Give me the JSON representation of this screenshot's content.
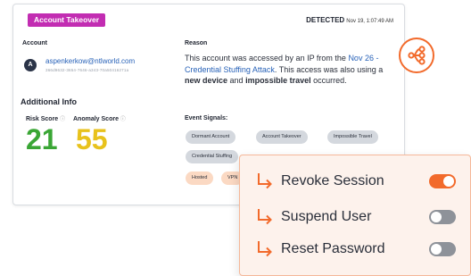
{
  "alert": {
    "badge_label": "Account Takeover",
    "detected_label": "DETECTED",
    "detected_time": "Nov 19, 1:07:49 AM"
  },
  "account": {
    "section_label": "Account",
    "avatar_letter": "A",
    "email": "aspenkerkow@ntlworld.com",
    "account_id": "366d9632-3654-7646-a343-70a50416271a"
  },
  "additional_info": {
    "title": "Additional Info",
    "risk_score_label": "Risk Score",
    "risk_score": "21",
    "anomaly_score_label": "Anomaly Score",
    "anomaly_score": "55",
    "info_glyph": "ⓘ"
  },
  "reason": {
    "section_label": "Reason",
    "text_1": "This account was accessed by an IP from the ",
    "link_text": "Nov 26 - Credential Stuffing Attack",
    "text_2": ". This access was also using a ",
    "bold_1": "new device",
    "text_3": " and ",
    "bold_2": "impossible travel",
    "text_4": " occurred."
  },
  "event_signals": {
    "section_label": "Event Signals:",
    "pills": [
      "Dormant Account",
      "Account Takeover",
      "Impossible Travel",
      "Credential Stuffing",
      "Hosted",
      "VPN"
    ]
  },
  "actions": {
    "revoke_label": "Revoke Session",
    "revoke_on": true,
    "suspend_label": "Suspend User",
    "suspend_on": false,
    "reset_label": "Reset Password",
    "reset_on": false
  },
  "colors": {
    "badge": "#c22db2",
    "accent": "#f26a2b",
    "risk_score": "#3aa635",
    "anomaly_score": "#e8c21c",
    "link": "#2862b8"
  },
  "icons": {
    "flow": "workflow-branch-icon",
    "action_arrow": "arrow-turn-down-right-icon"
  }
}
